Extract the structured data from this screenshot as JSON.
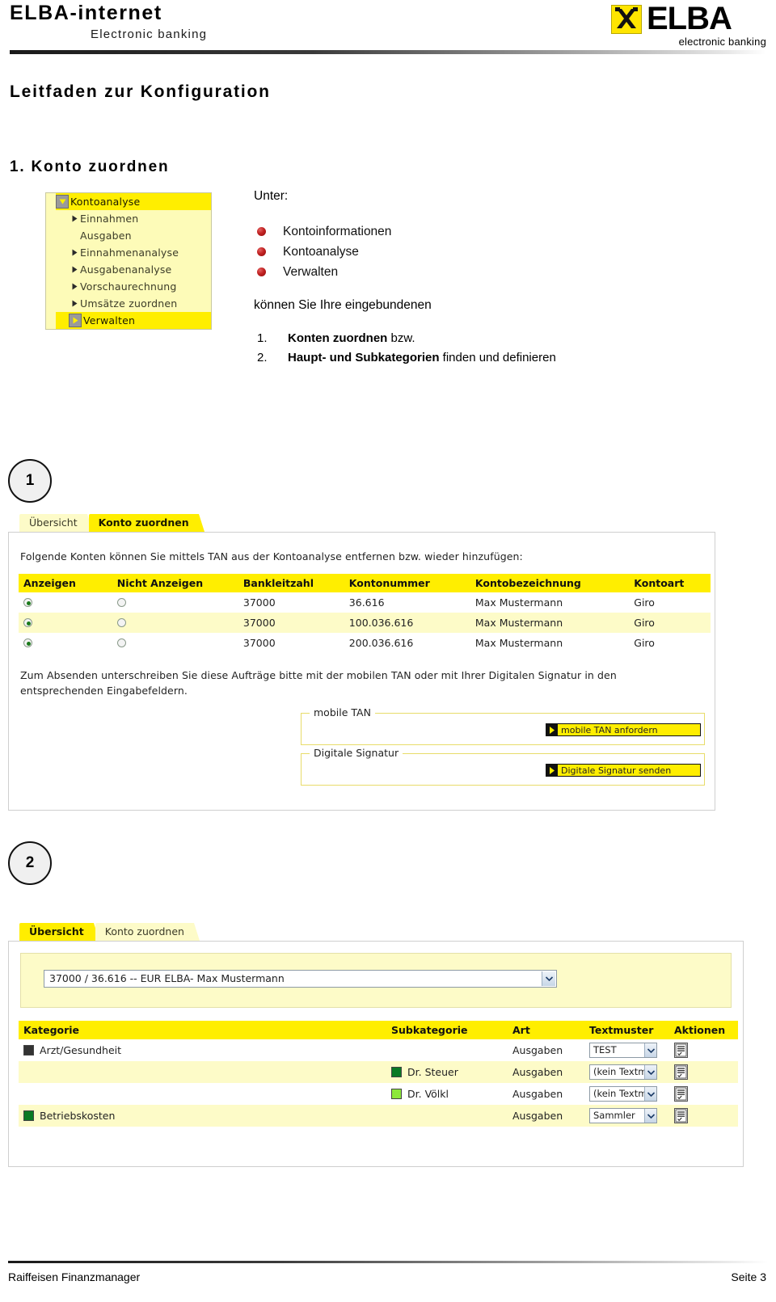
{
  "header": {
    "title": "ELBA-internet",
    "subtitle": "Electronic banking",
    "logo_word": "ELBA",
    "logo_tagline": "electronic banking"
  },
  "document": {
    "title": "Leitfaden zur Konfiguration",
    "section_title": "1. Konto zuordnen"
  },
  "tree_menu": {
    "items": [
      {
        "label": "Kontoanalyse",
        "level": 0,
        "toggle": "collapse-down",
        "highlight": true
      },
      {
        "label": "Einnahmen",
        "level": 1,
        "toggle": "expand-right",
        "highlight": false
      },
      {
        "label": "Ausgaben",
        "level": 1,
        "toggle": "none",
        "highlight": false
      },
      {
        "label": "Einnahmenanalyse",
        "level": 1,
        "toggle": "expand-right",
        "highlight": false
      },
      {
        "label": "Ausgabenanalyse",
        "level": 1,
        "toggle": "expand-right",
        "highlight": false
      },
      {
        "label": "Vorschaurechnung",
        "level": 1,
        "toggle": "expand-right",
        "highlight": false
      },
      {
        "label": "Umsätze zuordnen",
        "level": 1,
        "toggle": "expand-right",
        "highlight": false
      },
      {
        "label": "Verwalten",
        "level": 1,
        "toggle": "expand-right-sel",
        "highlight": true
      }
    ]
  },
  "intro": {
    "unter_label": "Unter:",
    "bullets": [
      "Kontoinformationen",
      "Kontoanalyse",
      "Verwalten"
    ],
    "koennen_text": "können Sie Ihre eingebundenen",
    "numbered": [
      {
        "num": "1.",
        "bold": "Konten zuordnen",
        "rest": " bzw."
      },
      {
        "num": "2.",
        "bold": "Haupt- und Subkategorien",
        "rest": " finden und definieren"
      }
    ]
  },
  "steps": {
    "one": "1",
    "two": "2"
  },
  "shot1": {
    "tabs": [
      {
        "label": "Übersicht",
        "active": false
      },
      {
        "label": "Konto zuordnen",
        "active": true
      }
    ],
    "intro_text": "Folgende Konten können Sie mittels TAN aus der Kontoanalyse entfernen bzw. wieder hinzufügen:",
    "table": {
      "headers": [
        "Anzeigen",
        "Nicht Anzeigen",
        "Bankleitzahl",
        "Kontonummer",
        "Kontobezeichnung",
        "Kontoart"
      ],
      "rows": [
        {
          "anzeigen": true,
          "nicht_anzeigen": false,
          "blz": "37000",
          "kontonummer": "36.616",
          "bezeichnung": "Max Mustermann",
          "kontoart": "Giro"
        },
        {
          "anzeigen": true,
          "nicht_anzeigen": false,
          "blz": "37000",
          "kontonummer": "100.036.616",
          "bezeichnung": "Max Mustermann",
          "kontoart": "Giro"
        },
        {
          "anzeigen": true,
          "nicht_anzeigen": false,
          "blz": "37000",
          "kontonummer": "200.036.616",
          "bezeichnung": "Max Mustermann",
          "kontoart": "Giro"
        }
      ]
    },
    "note_line1": "Zum Absenden unterschreiben Sie diese Aufträge bitte mit der mobilen TAN oder mit Ihrer Digitalen Signatur in den",
    "note_line2": "entsprechenden Eingabefeldern.",
    "mobile_tan": {
      "legend": "mobile TAN",
      "button": "mobile TAN anfordern"
    },
    "digital_sig": {
      "legend": "Digitale Signatur",
      "button": "Digitale Signatur senden"
    }
  },
  "shot2": {
    "tabs": [
      {
        "label": "Übersicht",
        "active": true
      },
      {
        "label": "Konto zuordnen",
        "active": false
      }
    ],
    "account_select": {
      "value": "37000 / 36.616 -- EUR ELBA- Max Mustermann"
    },
    "table": {
      "headers": [
        "Kategorie",
        "Subkategorie",
        "Art",
        "Textmuster",
        "Aktionen"
      ],
      "rows": [
        {
          "kategorie": "Arzt/Gesundheit",
          "kategorie_color": "#333333",
          "subkategorie": "",
          "subkategorie_color": "",
          "art": "Ausgaben",
          "textmuster": "TEST",
          "alt": false
        },
        {
          "kategorie": "",
          "kategorie_color": "",
          "subkategorie": "Dr. Steuer",
          "subkategorie_color": "#0a7a25",
          "art": "Ausgaben",
          "textmuster": "(kein Textm",
          "alt": true
        },
        {
          "kategorie": "",
          "kategorie_color": "",
          "subkategorie": "Dr. Völkl",
          "subkategorie_color": "#8ce83b",
          "art": "Ausgaben",
          "textmuster": "(kein Textm",
          "alt": false
        },
        {
          "kategorie": "Betriebskosten",
          "kategorie_color": "#0a7a25",
          "subkategorie": "",
          "subkategorie_color": "",
          "art": "Ausgaben",
          "textmuster": "Sammler",
          "alt": true
        }
      ]
    }
  },
  "footer": {
    "left": "Raiffeisen Finanzmanager",
    "right": "Seite 3"
  },
  "colors": {
    "accent_yellow": "#ffee00",
    "light_yellow": "#fdfbc8",
    "red_bullet": "#c22222"
  }
}
